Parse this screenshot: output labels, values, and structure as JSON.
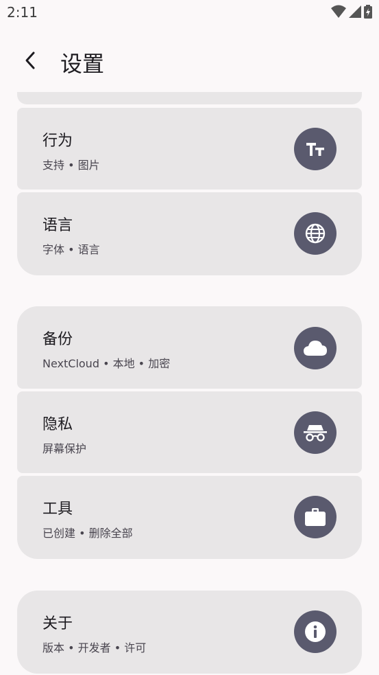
{
  "status": {
    "time": "2:11"
  },
  "header": {
    "title": "设置"
  },
  "groups": [
    {
      "items": [
        {
          "title": "行为",
          "subtitle": "支持 • 图片",
          "icon": "text-size-icon"
        },
        {
          "title": "语言",
          "subtitle": "字体 • 语言",
          "icon": "globe-icon"
        }
      ]
    },
    {
      "items": [
        {
          "title": "备份",
          "subtitle": "NextCloud • 本地 • 加密",
          "icon": "cloud-icon"
        },
        {
          "title": "隐私",
          "subtitle": "屏幕保护",
          "icon": "incognito-icon"
        },
        {
          "title": "工具",
          "subtitle": "已创建 • 删除全部",
          "icon": "briefcase-icon"
        }
      ]
    },
    {
      "items": [
        {
          "title": "关于",
          "subtitle": "版本 • 开发者 • 许可",
          "icon": "info-icon"
        }
      ]
    }
  ],
  "colors": {
    "background": "#fbf8f9",
    "card": "#e8e6e7",
    "icon_circle": "#5a5a6e"
  }
}
